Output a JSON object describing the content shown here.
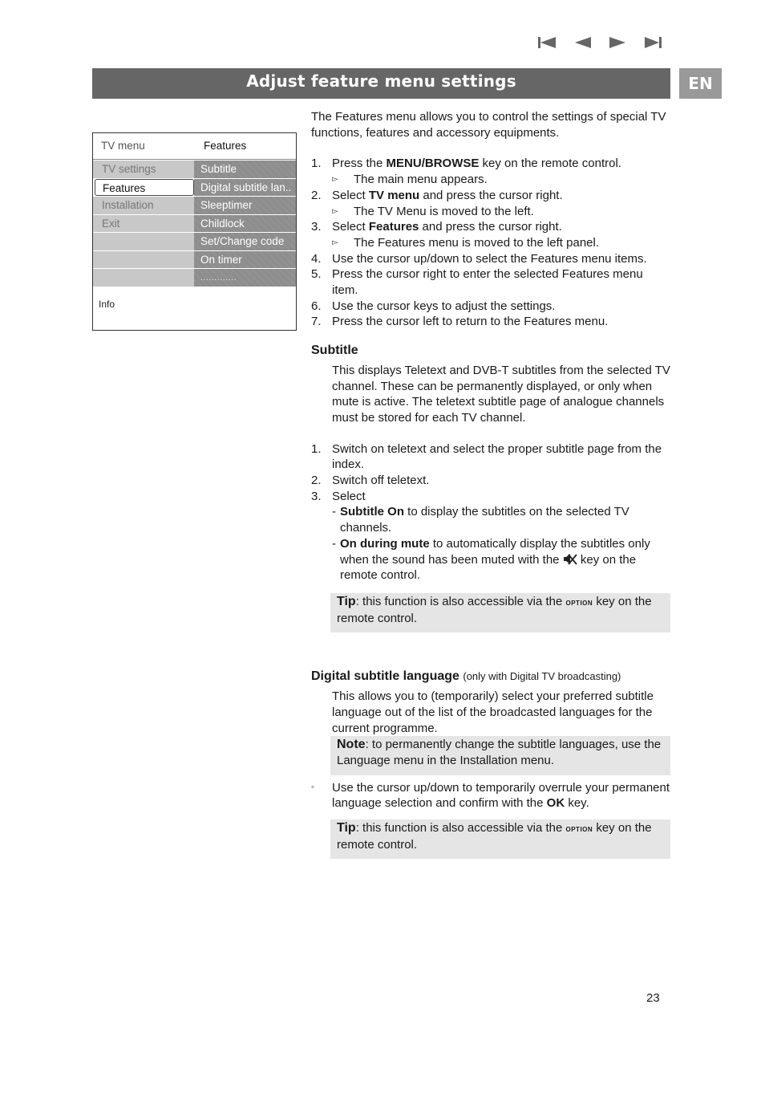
{
  "nav": {
    "icons": [
      {
        "name": "skip-to-first-icon"
      },
      {
        "name": "previous-icon"
      },
      {
        "name": "next-icon"
      },
      {
        "name": "skip-to-last-icon"
      }
    ],
    "color": "#666666"
  },
  "header": {
    "title": "Adjust feature menu settings",
    "language_badge": "EN",
    "bar_color": "#666666",
    "badge_color": "#999999"
  },
  "tv_menu": {
    "left_title": "TV menu",
    "right_title": "Features",
    "rows": [
      {
        "left": "TV settings",
        "right": "Subtitle"
      },
      {
        "left": "Features",
        "right": "Digital subtitle lan..",
        "selected": true
      },
      {
        "left": "Installation",
        "right": "Sleeptimer"
      },
      {
        "left": "Exit",
        "right": "Childlock"
      },
      {
        "left": "",
        "right": "Set/Change code"
      },
      {
        "left": "",
        "right": "On timer"
      },
      {
        "left": "",
        "right": "............."
      }
    ],
    "info_label": "Info"
  },
  "intro": "The Features menu allows you to control the settings of special TV functions, features and accessory equipments.",
  "steps": [
    {
      "n": "1.",
      "pre": "Press the ",
      "bold": "MENU/BROWSE",
      "post": " key on the remote control.",
      "result": "The main menu appears."
    },
    {
      "n": "2.",
      "pre": "Select ",
      "bold": "TV menu",
      "post": " and press the cursor right.",
      "result": "The TV Menu is moved to the left."
    },
    {
      "n": "3.",
      "pre": "Select ",
      "bold": "Features",
      "post": " and press the cursor right.",
      "result": "The Features menu is moved to the left panel."
    },
    {
      "n": "4.",
      "text": "Use the cursor up/down to select the Features menu items."
    },
    {
      "n": "5.",
      "text": "Press the cursor right to enter the selected Features menu item."
    },
    {
      "n": "6.",
      "text": "Use the cursor keys to adjust the settings."
    },
    {
      "n": "7.",
      "text": "Press the cursor left to return to the Features menu."
    }
  ],
  "subtitle_section": {
    "heading": "Subtitle",
    "description": "This displays Teletext and DVB-T subtitles from the selected TV channel. These can be permanently displayed, or only when mute is active. The teletext subtitle page of analogue channels must be stored for each TV channel.",
    "steps": [
      {
        "n": "1.",
        "text": "Switch on teletext and select the proper subtitle page from the index."
      },
      {
        "n": "2.",
        "text": "Switch off teletext."
      },
      {
        "n": "3.",
        "text": "Select"
      }
    ],
    "options": [
      {
        "bold": "Subtitle On",
        "text": " to display the subtitles on the selected TV channels."
      },
      {
        "bold": "On during mute",
        "text_before_icon": " to automatically display the subtitles only when the sound has been muted with the ",
        "icon": "mute-icon",
        "text_after_icon": " key on the remote control."
      }
    ],
    "tip": {
      "label": "Tip",
      "pre": ": this function is also accessible via the ",
      "key": "OPTION",
      "post": " key on the remote control."
    }
  },
  "digital_section": {
    "heading": "Digital subtitle language",
    "heading_note": "(only with Digital TV broadcasting)",
    "description": "This allows you to (temporarily) select your preferred subtitle language out of the list of the broadcasted languages for the current programme.",
    "note": {
      "label": "Note",
      "text": ": to permanently change the subtitle languages, use the Language menu in the Installation menu."
    },
    "bullet": {
      "symbol": "◦",
      "pre": "Use the cursor up/down to temporarily overrule your permanent language selection and confirm with the ",
      "bold": "OK",
      "post": " key."
    },
    "tip": {
      "label": "Tip",
      "pre": ": this function is also accessible via the ",
      "key": "OPTION",
      "post": " key on the remote control."
    }
  },
  "page_number": "23"
}
